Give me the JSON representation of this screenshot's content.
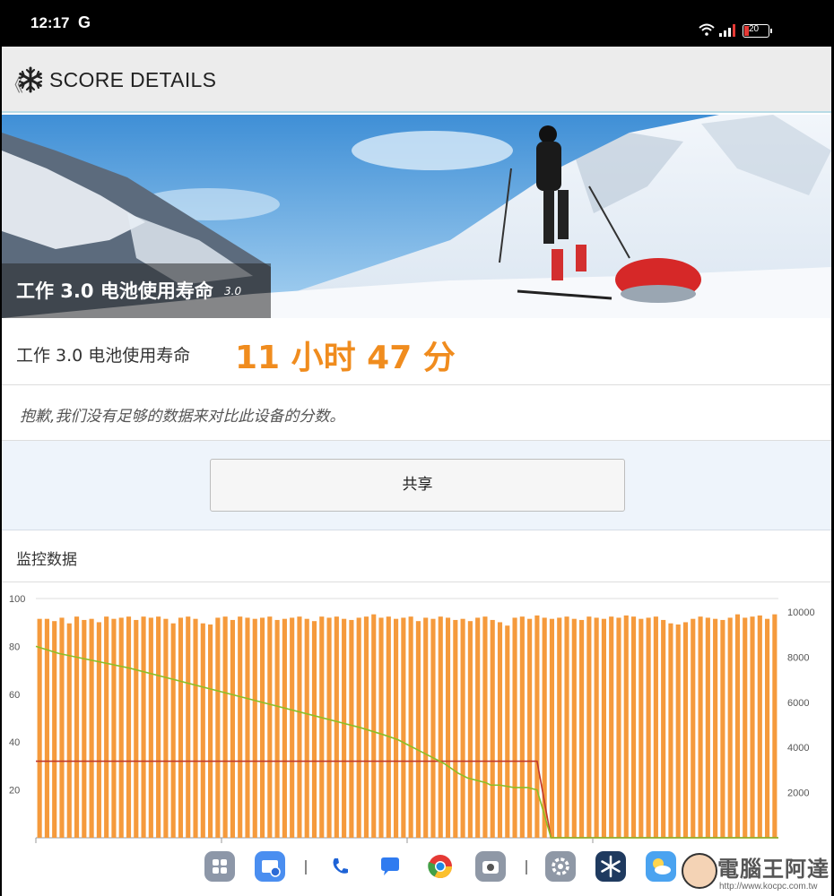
{
  "status": {
    "time": "12:17",
    "carrier_glyph": "G",
    "battery_level": "20",
    "icons": [
      "wifi-icon",
      "signal-icon",
      "battery-icon"
    ]
  },
  "app_bar": {
    "back_glyph": "《",
    "title": "SCORE DETAILS",
    "icon": "snowflake-icon"
  },
  "hero": {
    "title": "工作 3.0 电池使用寿命",
    "version": "3.0"
  },
  "score": {
    "label": "工作 3.0 电池使用寿命",
    "value": "11 小时 47 分"
  },
  "note": "抱歉,我们没有足够的数据来对比此设备的分数。",
  "share_button": "共享",
  "section_title": "监控数据",
  "colors": {
    "accent_orange": "#f08c1e",
    "bar_orange": "#f59a3c",
    "battery_line": "#8cbf26",
    "clock_line": "#c0392b"
  },
  "chart_data": {
    "type": "bar",
    "left_axis": {
      "ticks": [
        "100",
        "80",
        "60",
        "40",
        "20"
      ],
      "ylim": [
        0,
        100
      ]
    },
    "right_axis": {
      "ticks": [
        "10000",
        "8000",
        "6000",
        "4000",
        "2000"
      ],
      "ylim": [
        0,
        10600
      ]
    },
    "bar_series_right_axis": [
      9700,
      9700,
      9600,
      9750,
      9500,
      9800,
      9650,
      9700,
      9550,
      9800,
      9700,
      9750,
      9800,
      9650,
      9800,
      9750,
      9800,
      9700,
      9500,
      9750,
      9800,
      9700,
      9500,
      9450,
      9750,
      9800,
      9650,
      9800,
      9750,
      9700,
      9750,
      9800,
      9650,
      9700,
      9750,
      9800,
      9700,
      9600,
      9800,
      9750,
      9800,
      9700,
      9650,
      9750,
      9800,
      9900,
      9750,
      9800,
      9700,
      9750,
      9800,
      9600,
      9750,
      9700,
      9800,
      9750,
      9650,
      9700,
      9600,
      9750,
      9800,
      9650,
      9550,
      9400,
      9750,
      9800,
      9700,
      9850,
      9750,
      9700,
      9750,
      9800,
      9700,
      9650,
      9800,
      9750,
      9700,
      9800,
      9750,
      9850,
      9800,
      9700,
      9750,
      9800,
      9650,
      9500,
      9450,
      9550,
      9700,
      9800,
      9750,
      9700,
      9650,
      9750,
      9900,
      9750,
      9800,
      9850,
      9700,
      9900
    ],
    "battery_level_left_axis": [
      [
        0,
        80
      ],
      [
        5,
        77
      ],
      [
        10,
        75
      ],
      [
        20,
        71
      ],
      [
        30,
        66
      ],
      [
        40,
        61
      ],
      [
        50,
        56
      ],
      [
        60,
        51
      ],
      [
        70,
        46
      ],
      [
        75,
        43
      ],
      [
        78,
        41
      ],
      [
        80,
        39
      ],
      [
        82,
        37
      ],
      [
        85,
        34
      ],
      [
        88,
        31
      ],
      [
        91,
        27
      ],
      [
        93,
        25
      ],
      [
        95,
        24
      ],
      [
        97,
        23
      ],
      [
        98,
        22
      ],
      [
        100,
        22
      ],
      [
        103,
        21
      ],
      [
        106,
        21
      ],
      [
        108,
        20
      ],
      [
        111,
        0
      ],
      [
        160,
        0
      ]
    ],
    "cpu_clock_left_axis": [
      [
        0,
        32
      ],
      [
        108,
        32
      ],
      [
        111,
        0
      ],
      [
        160,
        0
      ]
    ]
  },
  "dock": {
    "apps": [
      "apps-grid-icon",
      "files-icon",
      "phone-icon",
      "messages-icon",
      "chrome-icon",
      "camera-icon",
      "settings-icon",
      "pcmark-icon",
      "weather-icon"
    ]
  },
  "watermark": {
    "brand": "電腦王阿達",
    "url": "http://www.kocpc.com.tw"
  }
}
